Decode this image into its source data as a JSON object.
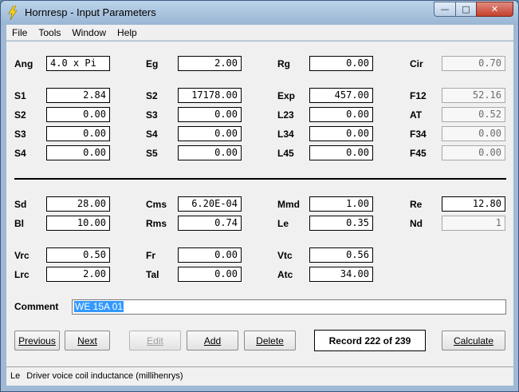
{
  "window": {
    "title": "Hornresp - Input Parameters",
    "app_icon": "lightning-icon"
  },
  "menu": [
    "File",
    "Tools",
    "Window",
    "Help"
  ],
  "horn": {
    "Ang": {
      "label": "Ang",
      "value": "4.0 x Pi"
    },
    "Eg": {
      "label": "Eg",
      "value": "2.00"
    },
    "Rg": {
      "label": "Rg",
      "value": "0.00"
    },
    "Cir": {
      "label": "Cir",
      "value": "0.70"
    },
    "S1": {
      "label": "S1",
      "value": "2.84"
    },
    "S2a": {
      "label": "S2",
      "value": "17178.00"
    },
    "Exp": {
      "label": "Exp",
      "value": "457.00"
    },
    "F12": {
      "label": "F12",
      "value": "52.16"
    },
    "S2b": {
      "label": "S2",
      "value": "0.00"
    },
    "S3a": {
      "label": "S3",
      "value": "0.00"
    },
    "L23": {
      "label": "L23",
      "value": "0.00"
    },
    "AT": {
      "label": "AT",
      "value": "0.52"
    },
    "S3b": {
      "label": "S3",
      "value": "0.00"
    },
    "S4a": {
      "label": "S4",
      "value": "0.00"
    },
    "L34": {
      "label": "L34",
      "value": "0.00"
    },
    "F34": {
      "label": "F34",
      "value": "0.00"
    },
    "S4b": {
      "label": "S4",
      "value": "0.00"
    },
    "S5": {
      "label": "S5",
      "value": "0.00"
    },
    "L45": {
      "label": "L45",
      "value": "0.00"
    },
    "F45": {
      "label": "F45",
      "value": "0.00"
    }
  },
  "driver": {
    "Sd": {
      "label": "Sd",
      "value": "28.00"
    },
    "Cms": {
      "label": "Cms",
      "value": "6.20E-04"
    },
    "Mmd": {
      "label": "Mmd",
      "value": "1.00"
    },
    "Re": {
      "label": "Re",
      "value": "12.80"
    },
    "Bl": {
      "label": "Bl",
      "value": "10.00"
    },
    "Rms": {
      "label": "Rms",
      "value": "0.74"
    },
    "Le": {
      "label": "Le",
      "value": "0.35"
    },
    "Nd": {
      "label": "Nd",
      "value": "1"
    },
    "Vrc": {
      "label": "Vrc",
      "value": "0.50"
    },
    "Fr": {
      "label": "Fr",
      "value": "0.00"
    },
    "Vtc": {
      "label": "Vtc",
      "value": "0.56"
    },
    "Lrc": {
      "label": "Lrc",
      "value": "2.00"
    },
    "Tal": {
      "label": "Tal",
      "value": "0.00"
    },
    "Atc": {
      "label": "Atc",
      "value": "34.00"
    }
  },
  "comment": {
    "label": "Comment",
    "value": "WE 15A 01"
  },
  "buttons": {
    "previous": "Previous",
    "next": "Next",
    "edit": "Edit",
    "add": "Add",
    "delete": "Delete",
    "calculate": "Calculate"
  },
  "record": "Record 222 of 239",
  "status": {
    "key": "Le",
    "text": "Driver voice coil inductance  (millihenrys)"
  }
}
